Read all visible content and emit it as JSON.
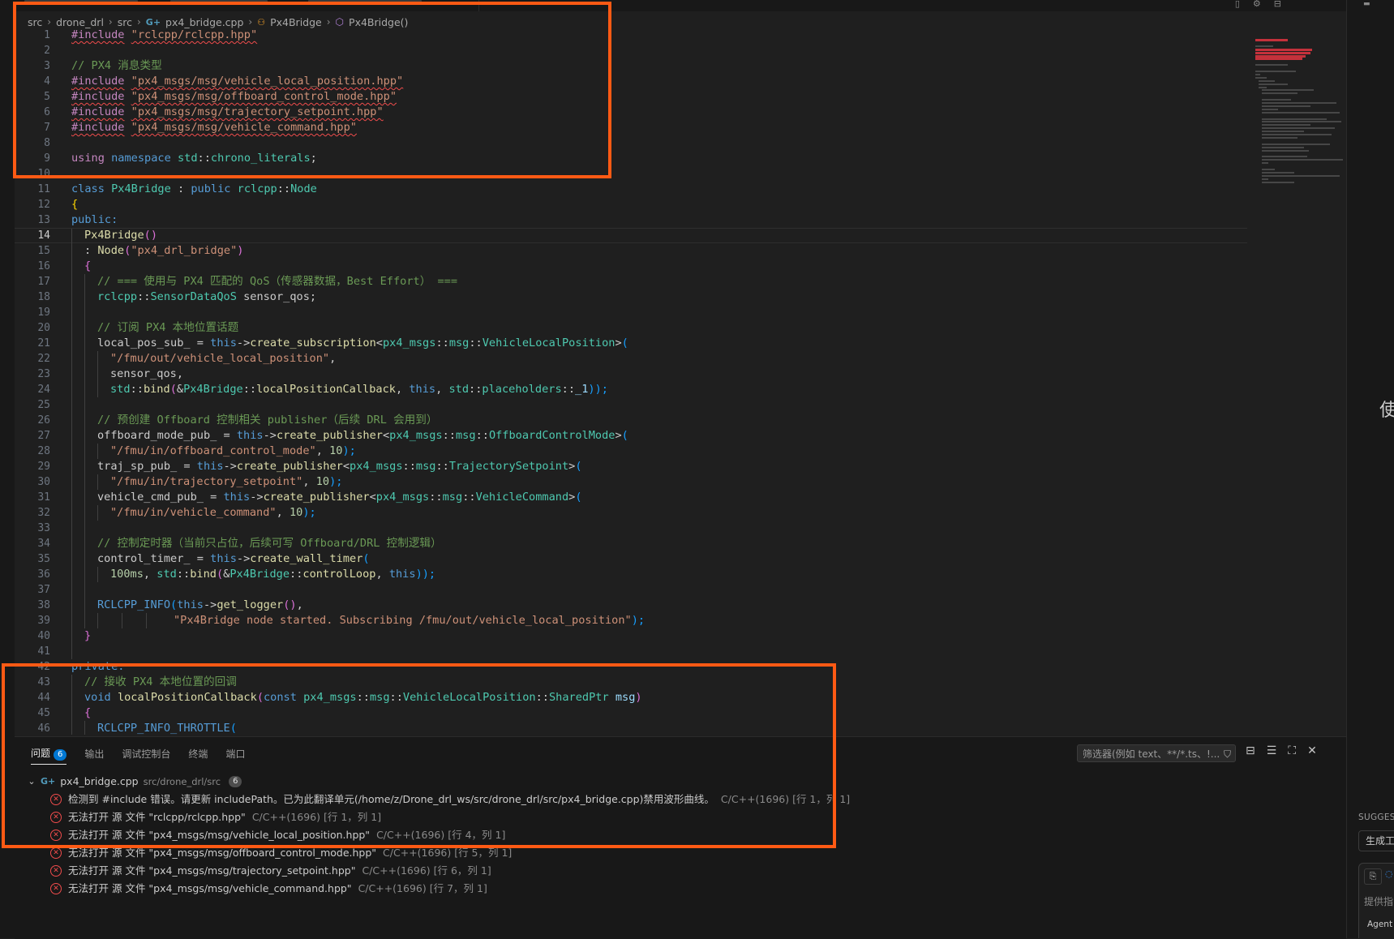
{
  "breadcrumb": [
    "src",
    "drone_drl",
    "src",
    "px4_bridge.cpp",
    "Px4Bridge",
    "Px4Bridge()"
  ],
  "code_lines": [
    "1",
    "2",
    "3",
    "4",
    "5",
    "6",
    "7",
    "8",
    "9",
    "10",
    "11",
    "12",
    "13",
    "14",
    "15",
    "16",
    "17",
    "18",
    "19",
    "20",
    "21",
    "22",
    "23",
    "24",
    "25",
    "26",
    "27",
    "28",
    "29",
    "30",
    "31",
    "32",
    "33",
    "34",
    "35",
    "36",
    "37",
    "38",
    "39",
    "40",
    "41",
    "42",
    "43",
    "44",
    "45",
    "46"
  ],
  "code": {
    "l1": {
      "pp": "#include",
      "str": "\"rclcpp/rclcpp.hpp\""
    },
    "l3": "// PX4 消息类型",
    "l4": {
      "pp": "#include",
      "str": "\"px4_msgs/msg/vehicle_local_position.hpp\""
    },
    "l5": {
      "pp": "#include",
      "str": "\"px4_msgs/msg/offboard_control_mode.hpp\""
    },
    "l6": {
      "pp": "#include",
      "str": "\"px4_msgs/msg/trajectory_setpoint.hpp\""
    },
    "l7": {
      "pp": "#include",
      "str": "\"px4_msgs/msg/vehicle_command.hpp\""
    },
    "l9": {
      "kw1": "using",
      "kw2": "namespace",
      "ns": "std",
      "sep": "::",
      "name": "chrono_literals",
      "end": ";"
    },
    "l11": {
      "kw": "class",
      "cls": "Px4Bridge",
      "c1": " : ",
      "kw2": "public",
      "ns": "rclcpp",
      "sep": "::",
      "base": "Node"
    },
    "l12": "{",
    "l13": "public:",
    "l14": {
      "fn": "Px4Bridge",
      "p": "()"
    },
    "l15": {
      "pre": ": ",
      "fn": "Node",
      "o": "(",
      "str": "\"px4_drl_bridge\"",
      "c": ")"
    },
    "l16": "{",
    "l17": "// === 使用与 PX4 匹配的 QoS（传感器数据，Best Effort） ===",
    "l18": {
      "ns": "rclcpp",
      "sep": "::",
      "ty": "SensorDataQoS",
      "rest": " sensor_qos;"
    },
    "l20": "// 订阅 PX4 本地位置话题",
    "l21": {
      "a": "local_pos_sub_ = ",
      "this": "this",
      "arrow": "->",
      "fn": "create_subscription",
      "lt": "<",
      "ns1": "px4_msgs",
      "s1": "::",
      "ns2": "msg",
      "s2": "::",
      "ty": "VehicleLocalPosition",
      "gt": ">",
      "o": "("
    },
    "l22": {
      "str": "\"/fmu/out/vehicle_local_position\"",
      "c": ","
    },
    "l23": "sensor_qos,",
    "l24": {
      "ns": "std",
      "sep": "::",
      "fn": "bind",
      "o": "(",
      "amp": "&",
      "cls": "Px4Bridge",
      "sep2": "::",
      "m": "localPositionCallback",
      "c1": ", ",
      "this": "this",
      "c2": ", ",
      "ns2": "std",
      "sep3": "::",
      "ph": "placeholders",
      "sep4": "::",
      "arg": "_1",
      "cl": "));"
    },
    "l26": "// 预创建 Offboard 控制相关 publisher（后续 DRL 会用到）",
    "l27": {
      "a": "offboard_mode_pub_ = ",
      "this": "this",
      "arrow": "->",
      "fn": "create_publisher",
      "lt": "<",
      "ns1": "px4_msgs",
      "s1": "::",
      "ns2": "msg",
      "s2": "::",
      "ty": "OffboardControlMode",
      "gt": ">",
      "o": "("
    },
    "l28": {
      "str": "\"/fmu/in/offboard_control_mode\"",
      "c": ", ",
      "num": "10",
      "e": ");"
    },
    "l29": {
      "a": "traj_sp_pub_ = ",
      "this": "this",
      "arrow": "->",
      "fn": "create_publisher",
      "lt": "<",
      "ns1": "px4_msgs",
      "s1": "::",
      "ns2": "msg",
      "s2": "::",
      "ty": "TrajectorySetpoint",
      "gt": ">",
      "o": "("
    },
    "l30": {
      "str": "\"/fmu/in/trajectory_setpoint\"",
      "c": ", ",
      "num": "10",
      "e": ");"
    },
    "l31": {
      "a": "vehicle_cmd_pub_ = ",
      "this": "this",
      "arrow": "->",
      "fn": "create_publisher",
      "lt": "<",
      "ns1": "px4_msgs",
      "s1": "::",
      "ns2": "msg",
      "s2": "::",
      "ty": "VehicleCommand",
      "gt": ">",
      "o": "("
    },
    "l32": {
      "str": "\"/fmu/in/vehicle_command\"",
      "c": ", ",
      "num": "10",
      "e": ");"
    },
    "l34": "// 控制定时器（当前只占位，后续可写 Offboard/DRL 控制逻辑）",
    "l35": {
      "a": "control_timer_ = ",
      "this": "this",
      "arrow": "->",
      "fn": "create_wall_timer",
      "o": "("
    },
    "l36": {
      "num": "100ms",
      "c0": ", ",
      "ns": "std",
      "sep": "::",
      "fn": "bind",
      "o": "(",
      "amp": "&",
      "cls": "Px4Bridge",
      "sep2": "::",
      "m": "controlLoop",
      "c1": ", ",
      "this": "this",
      "cl": "));"
    },
    "l38": {
      "mac": "RCLCPP_INFO",
      "o": "(",
      "this": "this",
      "arrow": "->",
      "fn": "get_logger",
      "p": "()",
      "c": ","
    },
    "l39": {
      "str": "\"Px4Bridge node started. Subscribing /fmu/out/vehicle_local_position\"",
      "e": ");"
    },
    "l40": "}",
    "l42": "private:",
    "l43": "// 接收 PX4 本地位置的回调",
    "l44": {
      "kw": "void",
      "fn": "localPositionCallback",
      "o": "(",
      "kw2": "const",
      "ns1": "px4_msgs",
      "s1": "::",
      "ns2": "msg",
      "s2": "::",
      "ty": "VehicleLocalPosition",
      "s3": "::",
      "ty2": "SharedPtr",
      "sp": " ",
      "arg": "msg",
      "c": ")"
    },
    "l45": "{",
    "l46": {
      "mac": "RCLCPP_INFO_THROTTLE",
      "o": "("
    }
  },
  "panel": {
    "tabs": [
      "问题",
      "输出",
      "调试控制台",
      "终端",
      "端口"
    ],
    "problems_count": "6",
    "filter_placeholder": "筛选器(例如 text、**/*.ts、!...",
    "file": {
      "name": "px4_bridge.cpp",
      "path": "src/drone_drl/src",
      "count": "6"
    },
    "problems": [
      {
        "msg": "检测到 #include 错误。请更新 includePath。已为此翻译单元(/home/z/Drone_drl_ws/src/drone_drl/src/px4_bridge.cpp)禁用波形曲线。",
        "src": "C/C++(1696) [行 1，列 1]"
      },
      {
        "msg": "无法打开 源 文件 \"rclcpp/rclcpp.hpp\"",
        "src": "C/C++(1696) [行 1，列 1]"
      },
      {
        "msg": "无法打开 源 文件 \"px4_msgs/msg/vehicle_local_position.hpp\"",
        "src": "C/C++(1696) [行 4，列 1]"
      },
      {
        "msg": "无法打开 源 文件 \"px4_msgs/msg/offboard_control_mode.hpp\"",
        "src": "C/C++(1696) [行 5，列 1]"
      },
      {
        "msg": "无法打开 源 文件 \"px4_msgs/msg/trajectory_setpoint.hpp\"",
        "src": "C/C++(1696) [行 6，列 1]"
      },
      {
        "msg": "无法打开 源 文件 \"px4_msgs/msg/vehicle_command.hpp\"",
        "src": "C/C++(1696) [行 7，列 1]"
      }
    ]
  },
  "sidebar": {
    "big_char": "使",
    "suggest_label": "SUGGES",
    "suggest_button": "生成工",
    "input_placeholder": "提供指",
    "agent_label": "Agent"
  },
  "icons": {
    "file": "cpp-file-icon",
    "class": "class-icon",
    "method": "method-icon",
    "error": "error-circle-icon",
    "chevron": "chevron-down-icon",
    "filter": "filter-icon",
    "collapse": "collapse-all-icon",
    "wrap": "word-wrap-icon",
    "maximize": "maximize-icon",
    "close": "close-icon"
  },
  "colors": {
    "highlight": "#ff5a14",
    "error": "#f14c4c",
    "accent": "#0078d4"
  }
}
